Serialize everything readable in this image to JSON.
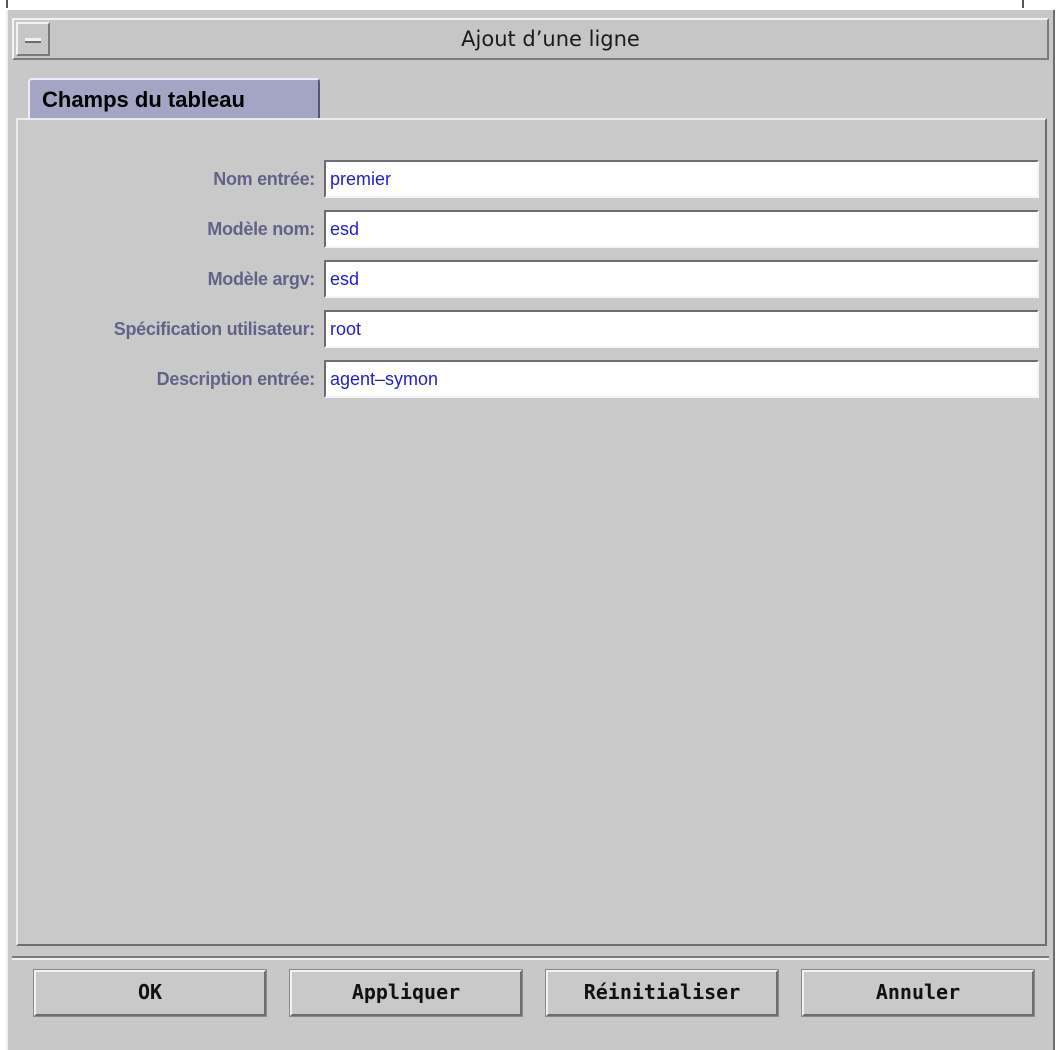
{
  "window": {
    "title": "Ajout d’une ligne",
    "menu_icon": "window-menu-icon"
  },
  "tabs": [
    {
      "label": "Champs du tableau",
      "selected": true
    }
  ],
  "form": {
    "fields": [
      {
        "label": "Nom entrée:",
        "value": "premier"
      },
      {
        "label": "Modèle nom:",
        "value": "esd"
      },
      {
        "label": "Modèle argv:",
        "value": "esd"
      },
      {
        "label": "Spécification utilisateur:",
        "value": "root"
      },
      {
        "label": "Description entrée:",
        "value": "agent–symon"
      }
    ]
  },
  "buttons": {
    "ok": "OK",
    "apply": "Appliquer",
    "reset": "Réinitialiser",
    "cancel": "Annuler"
  },
  "colors": {
    "label_text": "#63638a",
    "input_text": "#2020d0",
    "tab_background": "#a4a4c4",
    "window_background": "#c8c8c8"
  }
}
